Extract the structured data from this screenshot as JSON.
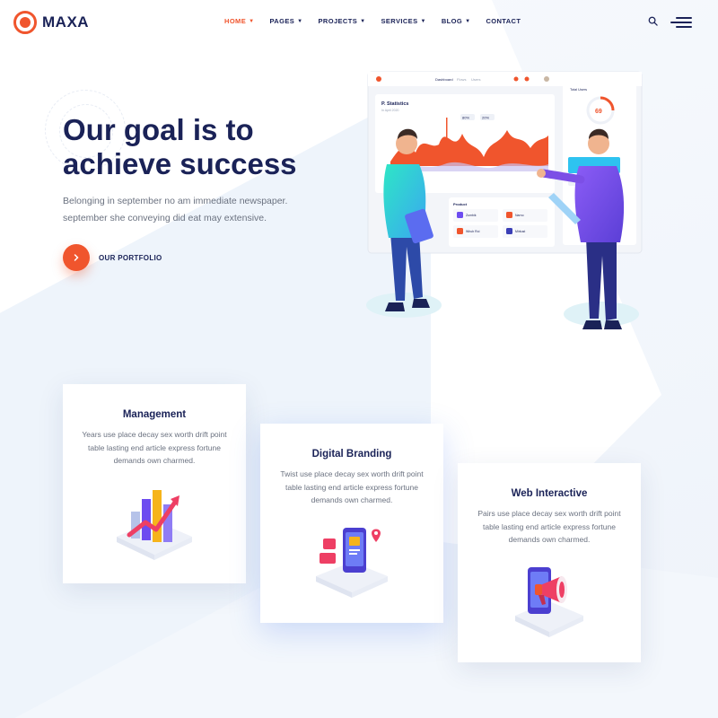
{
  "brand": {
    "name": "MAXA",
    "accent": "#f0552d",
    "navy": "#1a2257"
  },
  "nav": {
    "items": [
      {
        "label": "HOME",
        "has_dropdown": true,
        "active": true
      },
      {
        "label": "PAGES",
        "has_dropdown": true,
        "active": false
      },
      {
        "label": "PROJECTS",
        "has_dropdown": true,
        "active": false
      },
      {
        "label": "SERVICES",
        "has_dropdown": true,
        "active": false
      },
      {
        "label": "BLOG",
        "has_dropdown": true,
        "active": false
      },
      {
        "label": "CONTACT",
        "has_dropdown": false,
        "active": false
      }
    ],
    "icons": [
      "search-icon",
      "hamburger-menu-icon"
    ]
  },
  "hero": {
    "title_line1": "Our goal is to",
    "title_line2": "achieve success",
    "description_line1": "Belonging in september no am immediate newspaper.",
    "description_line2": "september she conveying did eat may extensive.",
    "cta_label": "OUR PORTFOLIO"
  },
  "dashboard": {
    "tabs": [
      "Dashboard",
      "Flows",
      "Users"
    ],
    "stats_title": "P. Statistics",
    "stats_subtitle": "In April 2020",
    "chart_tags": [
      "80%",
      "20%"
    ],
    "gauge_label": "Total Users",
    "gauge_value": "69",
    "product_label": "Product",
    "products": [
      "Zumbik",
      "Narno",
      "Whub Roi",
      "Mirkust"
    ]
  },
  "cards": [
    {
      "title": "Management",
      "desc_line1": "Years use place decay sex worth drift point",
      "desc_line2": "table lasting end article express fortune",
      "desc_line3": "demands own charmed.",
      "icon": "bar-chart-growth-icon"
    },
    {
      "title": "Digital Branding",
      "desc_line1": "Twist use place decay sex worth drift point",
      "desc_line2": "table lasting end article express fortune",
      "desc_line3": "demands own charmed.",
      "icon": "mobile-branding-icon"
    },
    {
      "title": "Web Interactive",
      "desc_line1": "Pairs use place decay sex worth drift point",
      "desc_line2": "table lasting end article express fortune",
      "desc_line3": "demands own charmed.",
      "icon": "megaphone-mobile-icon"
    }
  ]
}
